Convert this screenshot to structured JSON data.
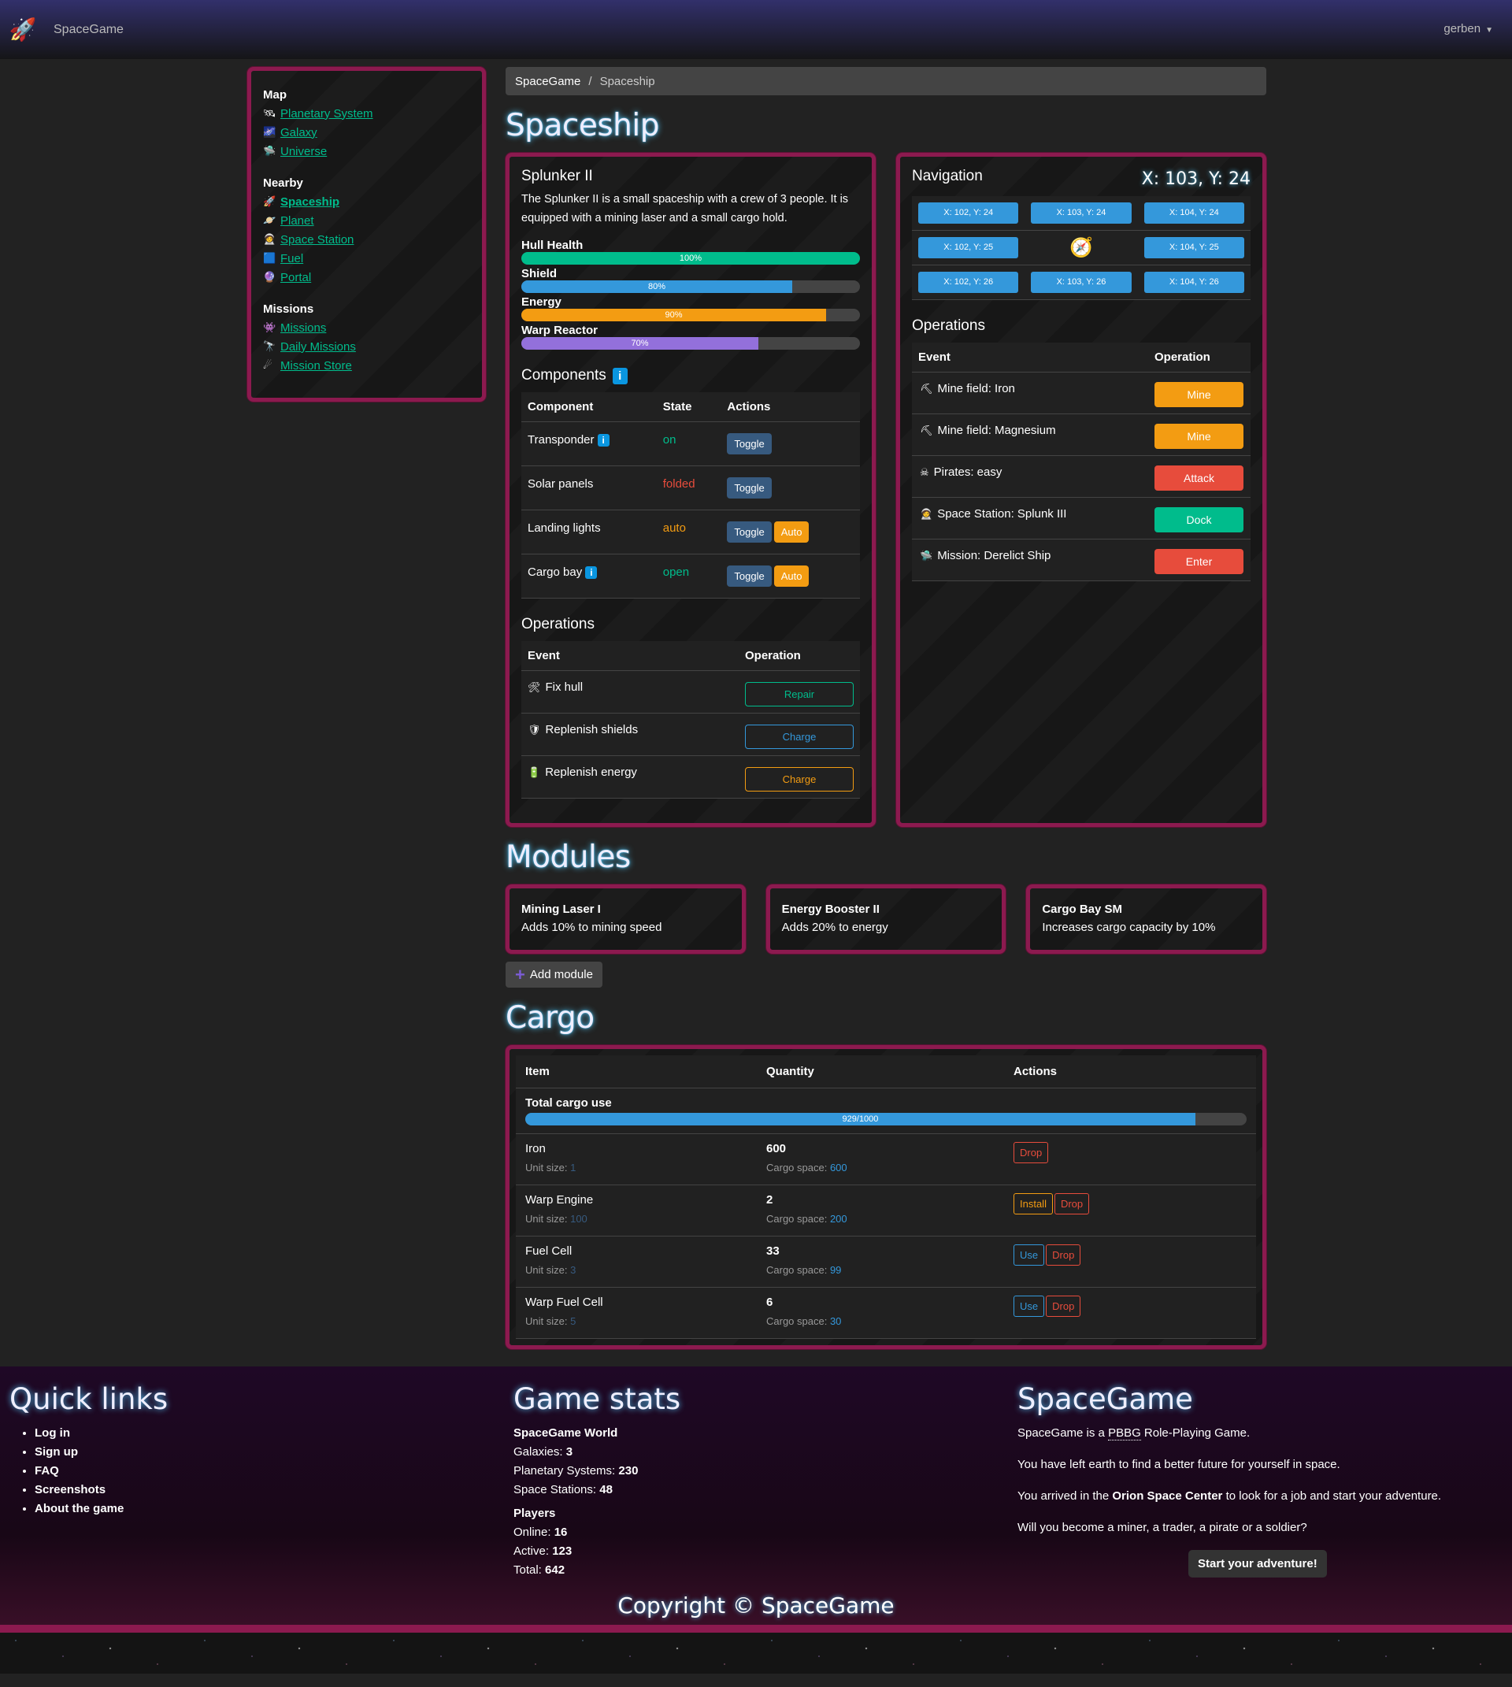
{
  "navbar": {
    "brand": "SpaceGame",
    "brand_icon": "rocket-icon",
    "user": "gerben"
  },
  "sidebar": {
    "sections": [
      {
        "title": "Map",
        "items": [
          {
            "icon": "🛰",
            "label": "Planetary System"
          },
          {
            "icon": "🌌",
            "label": "Galaxy"
          },
          {
            "icon": "🛸",
            "label": "Universe"
          }
        ]
      },
      {
        "title": "Nearby",
        "items": [
          {
            "icon": "🚀",
            "label": "Spaceship",
            "active": true
          },
          {
            "icon": "🪐",
            "label": "Planet"
          },
          {
            "icon": "🧑‍🚀",
            "label": "Space Station"
          },
          {
            "icon": "🟦",
            "label": "Fuel"
          },
          {
            "icon": "🔮",
            "label": "Portal"
          }
        ]
      },
      {
        "title": "Missions",
        "items": [
          {
            "icon": "👾",
            "label": "Missions"
          },
          {
            "icon": "🔭",
            "label": "Daily Missions"
          },
          {
            "icon": "☄",
            "label": "Mission Store"
          }
        ]
      }
    ]
  },
  "breadcrumb": {
    "root": "SpaceGame",
    "separator": "/",
    "current": "Spaceship"
  },
  "page_title": "Spaceship",
  "ship": {
    "name": "Splunker II",
    "description": "The Splunker II is a small spaceship with a crew of 3 people. It is equipped with a mining laser and a small cargo hold.",
    "bars": [
      {
        "label": "Hull Health",
        "value": 100,
        "text": "100%",
        "color": "#00bc8c"
      },
      {
        "label": "Shield",
        "value": 80,
        "text": "80%",
        "color": "#3498db"
      },
      {
        "label": "Energy",
        "value": 90,
        "text": "90%",
        "color": "#f39c12"
      },
      {
        "label": "Warp Reactor",
        "value": 70,
        "text": "70%",
        "color": "#9370db"
      }
    ],
    "components_title": "Components",
    "components_headers": [
      "Component",
      "State",
      "Actions"
    ],
    "components": [
      {
        "name": "Transponder",
        "info": true,
        "state": "on",
        "state_class": "state-on",
        "actions": [
          "Toggle"
        ]
      },
      {
        "name": "Solar panels",
        "info": false,
        "state": "folded",
        "state_class": "state-folded",
        "actions": [
          "Toggle"
        ]
      },
      {
        "name": "Landing lights",
        "info": false,
        "state": "auto",
        "state_class": "state-auto",
        "actions": [
          "Toggle",
          "Auto"
        ]
      },
      {
        "name": "Cargo bay",
        "info": true,
        "state": "open",
        "state_class": "state-on",
        "actions": [
          "Toggle",
          "Auto"
        ]
      }
    ],
    "operations_title": "Operations",
    "operations_headers": [
      "Event",
      "Operation"
    ],
    "operations": [
      {
        "icon": "🛠",
        "icon_name": "tools-icon",
        "event": "Fix hull",
        "button": "Repair",
        "color": "#00bc8c"
      },
      {
        "icon": "🛡",
        "icon_name": "shield-icon",
        "event": "Replenish shields",
        "button": "Charge",
        "color": "#3498db"
      },
      {
        "icon": "🔋",
        "icon_name": "battery-icon",
        "event": "Replenish energy",
        "button": "Charge",
        "color": "#f39c12"
      }
    ]
  },
  "navigation": {
    "title": "Navigation",
    "current": "X: 103, Y: 24",
    "grid": [
      [
        "X: 102, Y: 24",
        "X: 103, Y: 24",
        "X: 104, Y: 24"
      ],
      [
        "X: 102, Y: 25",
        "🧭",
        "X: 104, Y: 25"
      ],
      [
        "X: 102, Y: 26",
        "X: 103, Y: 26",
        "X: 104, Y: 26"
      ]
    ],
    "operations_title": "Operations",
    "operations_headers": [
      "Event",
      "Operation"
    ],
    "operations": [
      {
        "icon": "⛏",
        "icon_name": "pickaxe-icon",
        "event": "Mine field: Iron",
        "button": "Mine",
        "color": "#f39c12"
      },
      {
        "icon": "⛏",
        "icon_name": "pickaxe-icon",
        "event": "Mine field: Magnesium",
        "button": "Mine",
        "color": "#f39c12"
      },
      {
        "icon": "☠",
        "icon_name": "skull-icon",
        "event": "Pirates: easy",
        "button": "Attack",
        "color": "#e74c3c"
      },
      {
        "icon": "🧑‍🚀",
        "icon_name": "astronaut-icon",
        "event": "Space Station: Splunk III",
        "button": "Dock",
        "color": "#00bc8c"
      },
      {
        "icon": "🛸",
        "icon_name": "ufo-icon",
        "event": "Mission: Derelict Ship",
        "button": "Enter",
        "color": "#e74c3c"
      }
    ]
  },
  "modules_title": "Modules",
  "modules": [
    {
      "title": "Mining Laser I",
      "description": "Adds 10% to mining speed"
    },
    {
      "title": "Energy Booster II",
      "description": "Adds 20% to energy"
    },
    {
      "title": "Cargo Bay SM",
      "description": "Increases cargo capacity by 10%"
    }
  ],
  "add_module_label": "Add module",
  "cargo_title": "Cargo",
  "cargo": {
    "headers": [
      "Item",
      "Quantity",
      "Actions"
    ],
    "total_label": "Total cargo use",
    "total_used": 929,
    "total_capacity": 1000,
    "total_text": "929/1000",
    "unit_size_label": "Unit size:",
    "cargo_space_label": "Cargo space:",
    "items": [
      {
        "name": "Iron",
        "unit_size": "1",
        "quantity": "600",
        "space": "600",
        "actions": [
          {
            "label": "Drop",
            "color": "#e74c3c"
          }
        ]
      },
      {
        "name": "Warp Engine",
        "unit_size": "100",
        "quantity": "2",
        "space": "200",
        "actions": [
          {
            "label": "Install",
            "color": "#f39c12"
          },
          {
            "label": "Drop",
            "color": "#e74c3c"
          }
        ]
      },
      {
        "name": "Fuel Cell",
        "unit_size": "3",
        "quantity": "33",
        "space": "99",
        "actions": [
          {
            "label": "Use",
            "color": "#3498db"
          },
          {
            "label": "Drop",
            "color": "#e74c3c"
          }
        ]
      },
      {
        "name": "Warp Fuel Cell",
        "unit_size": "5",
        "quantity": "6",
        "space": "30",
        "actions": [
          {
            "label": "Use",
            "color": "#3498db"
          },
          {
            "label": "Drop",
            "color": "#e74c3c"
          }
        ]
      }
    ]
  },
  "footer": {
    "quick_links_title": "Quick links",
    "quick_links": [
      "Log in",
      "Sign up",
      "FAQ",
      "Screenshots",
      "About the game"
    ],
    "stats_title": "Game stats",
    "world_title": "SpaceGame World",
    "world_stats": [
      {
        "label": "Galaxies:",
        "value": "3"
      },
      {
        "label": "Planetary Systems:",
        "value": "230"
      },
      {
        "label": "Space Stations:",
        "value": "48"
      }
    ],
    "players_title": "Players",
    "player_stats": [
      {
        "label": "Online:",
        "value": "16"
      },
      {
        "label": "Active:",
        "value": "123"
      },
      {
        "label": "Total:",
        "value": "642"
      }
    ],
    "about_title": "SpaceGame",
    "about_p1_pre": "SpaceGame is a ",
    "about_p1_abbr": "PBBG",
    "about_p1_post": " Role-Playing Game.",
    "about_p2": "You have left earth to find a better future for yourself in space.",
    "about_p3_pre": "You arrived in the ",
    "about_p3_bold": "Orion Space Center",
    "about_p3_post": " to look for a job and start your adventure.",
    "about_p4": "Will you become a miner, a trader, a pirate or a soldier?",
    "start_button": "Start your adventure!",
    "copyright": "Copyright © SpaceGame"
  }
}
